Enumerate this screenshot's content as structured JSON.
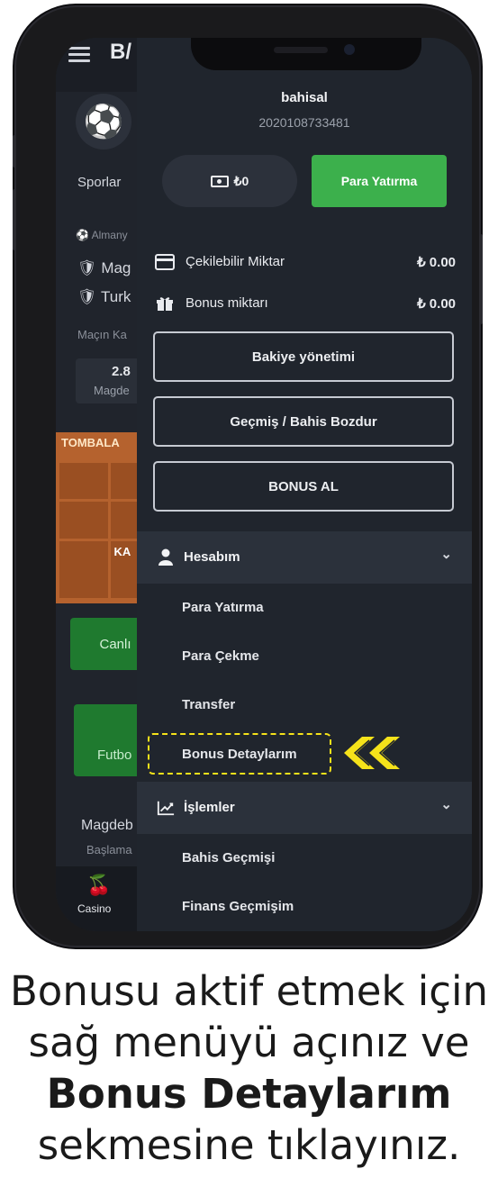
{
  "background_app": {
    "brand": "B/",
    "sport_label": "Sporlar",
    "league": "Almany",
    "team1": "Mag",
    "team2": "Turk",
    "match_label": "Maçın Ka",
    "odds_value": "2.8",
    "odds_team": "Magde",
    "tombala_title": "TOMBALA",
    "tombala_corner": "KA",
    "live_button": "Canlı",
    "football_label": "Futbo",
    "match_team": "Magdeb",
    "match_status": "Başlama",
    "casino_label": "Casino"
  },
  "drawer": {
    "username": "bahisal",
    "user_id": "2020108733481",
    "balance": "₺0",
    "deposit_button": "Para Yatırma",
    "withdrawable_label": "Çekilebilir Miktar",
    "withdrawable_value": "₺ 0.00",
    "bonus_amount_label": "Bonus miktarı",
    "bonus_amount_value": "₺ 0.00",
    "buttons": [
      {
        "label": "Bakiye yönetimi"
      },
      {
        "label": "Geçmiş / Bahis Bozdur"
      },
      {
        "label": "BONUS AL"
      }
    ],
    "account_section": {
      "title": "Hesabım",
      "items": [
        "Para Yatırma",
        "Para Çekme",
        "Transfer",
        "Bonus Detaylarım"
      ]
    },
    "transactions_section": {
      "title": "İşlemler",
      "items": [
        "Bahis Geçmişi",
        "Finans Geçmişim"
      ]
    }
  },
  "caption": {
    "line1": "Bonusu aktif etmek için",
    "line2": "sağ menüyü açınız ve",
    "line3": "Bonus Detaylarım",
    "line4": "sekmesine tıklayınız."
  },
  "colors": {
    "accent_green": "#3cb04c",
    "highlight_yellow": "#f5e21a",
    "drawer_bg": "#20252d"
  }
}
